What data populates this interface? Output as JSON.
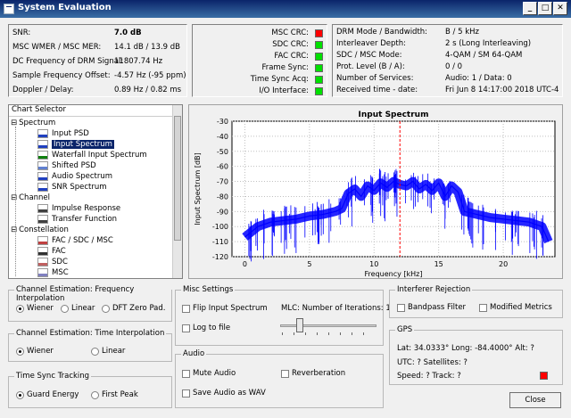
{
  "window": {
    "title": "System Evaluation",
    "buttons": [
      "_",
      "□",
      "✕"
    ]
  },
  "measurements": [
    {
      "label": "SNR:",
      "value": "7.0 dB"
    },
    {
      "label": "MSC WMER / MSC MER:",
      "value": "14.1 dB / 13.9 dB"
    },
    {
      "label": "DC Frequency of DRM Signal:",
      "value": "11807.74 Hz"
    },
    {
      "label": "Sample Frequency Offset:",
      "value": "-4.57 Hz (-95 ppm)"
    },
    {
      "label": "Doppler / Delay:",
      "value": "0.89 Hz / 0.82 ms"
    }
  ],
  "status_leds": [
    {
      "label": "MSC CRC:",
      "color": "#ff0000"
    },
    {
      "label": "SDC CRC:",
      "color": "#00e000"
    },
    {
      "label": "FAC CRC:",
      "color": "#00e000"
    },
    {
      "label": "Frame Sync:",
      "color": "#00e000"
    },
    {
      "label": "Time Sync Acq:",
      "color": "#00e000"
    },
    {
      "label": "I/O Interface:",
      "color": "#00e000"
    }
  ],
  "drm_info": [
    {
      "label": "DRM Mode / Bandwidth:",
      "value": "B / 5 kHz"
    },
    {
      "label": "Interleaver Depth:",
      "value": "2 s (Long Interleaving)"
    },
    {
      "label": "SDC / MSC Mode:",
      "value": "4-QAM / SM 64-QAM"
    },
    {
      "label": "Prot. Level (B / A):",
      "value": "0 / 0"
    },
    {
      "label": "Number of Services:",
      "value": "Audio: 1 / Data: 0"
    },
    {
      "label": "Received time - date:",
      "value": "Fri Jun 8 14:17:00 2018 UTC-4"
    }
  ],
  "chart_selector": {
    "header": "Chart Selector",
    "items": [
      {
        "label": "Spectrum",
        "level": 0,
        "icon": "tree-expand-icon"
      },
      {
        "label": "Input PSD",
        "level": 1,
        "icon": "psd-icon"
      },
      {
        "label": "Input Spectrum",
        "level": 1,
        "icon": "spectrum-icon",
        "selected": true
      },
      {
        "label": "Waterfall Input Spectrum",
        "level": 1,
        "icon": "waterfall-icon"
      },
      {
        "label": "Shifted PSD",
        "level": 1,
        "icon": "shifted-psd-icon"
      },
      {
        "label": "Audio Spectrum",
        "level": 1,
        "icon": "audio-spectrum-icon"
      },
      {
        "label": "SNR Spectrum",
        "level": 1,
        "icon": "snr-spectrum-icon"
      },
      {
        "label": "Channel",
        "level": 0,
        "icon": "tree-expand-icon"
      },
      {
        "label": "Impulse Response",
        "level": 1,
        "icon": "impulse-icon"
      },
      {
        "label": "Transfer Function",
        "level": 1,
        "icon": "transfer-icon"
      },
      {
        "label": "Constellation",
        "level": 0,
        "icon": "tree-expand-icon"
      },
      {
        "label": "FAC / SDC / MSC",
        "level": 1,
        "icon": "constellation-icon"
      },
      {
        "label": "FAC",
        "level": 1,
        "icon": "fac-icon"
      },
      {
        "label": "SDC",
        "level": 1,
        "icon": "sdc-icon"
      },
      {
        "label": "MSC",
        "level": 1,
        "icon": "msc-icon"
      }
    ]
  },
  "chart_data": {
    "type": "line",
    "title": "Input Spectrum",
    "xlabel": "Frequency [kHz]",
    "ylabel": "Input Spectrum [dB]",
    "xlim": [
      -1,
      24
    ],
    "ylim": [
      -120,
      -30
    ],
    "xticks": [
      0,
      5,
      10,
      15,
      20
    ],
    "yticks": [
      -30,
      -40,
      -50,
      -60,
      -70,
      -80,
      -90,
      -100,
      -110,
      -120
    ],
    "grid": true,
    "marker_x": 12,
    "series": [
      {
        "color": "#0000ff",
        "x": [
          0,
          1,
          2,
          3,
          4,
          5,
          6,
          7,
          7.5,
          8,
          8.5,
          9,
          9.5,
          10,
          10.5,
          11,
          11.5,
          12,
          12.5,
          13,
          13.5,
          14,
          14.5,
          15,
          15.5,
          16,
          16.5,
          17,
          18,
          19,
          20,
          21,
          22,
          23,
          23.5
        ],
        "values": [
          -107,
          -100,
          -97,
          -96,
          -95,
          -93,
          -92,
          -90,
          -88,
          -78,
          -75,
          -80,
          -73,
          -76,
          -71,
          -74,
          -70,
          -72,
          -73,
          -70,
          -75,
          -72,
          -76,
          -71,
          -80,
          -73,
          -77,
          -90,
          -92,
          -94,
          -95,
          -96,
          -97,
          -100,
          -110
        ]
      }
    ]
  },
  "freq_interp": {
    "title": "Channel Estimation: Frequency Interpolation",
    "options": [
      {
        "label": "Wiener",
        "checked": true
      },
      {
        "label": "Linear",
        "checked": false
      },
      {
        "label": "DFT Zero Pad.",
        "checked": false
      }
    ]
  },
  "time_interp": {
    "title": "Channel Estimation: Time Interpolation",
    "options": [
      {
        "label": "Wiener",
        "checked": true
      },
      {
        "label": "Linear",
        "checked": false
      }
    ]
  },
  "time_sync": {
    "title": "Time Sync Tracking",
    "options": [
      {
        "label": "Guard Energy",
        "checked": true
      },
      {
        "label": "First Peak",
        "checked": false
      }
    ]
  },
  "misc": {
    "title": "Misc Settings",
    "flip_label": "Flip Input Spectrum",
    "log_label": "Log to file",
    "mlc_label": "MLC: Number of Iterations: 1",
    "mlc_level": 0.2
  },
  "audio": {
    "title": "Audio",
    "mute_label": "Mute Audio",
    "reverb_label": "Reverberation",
    "save_label": "Save Audio as WAV"
  },
  "interferer": {
    "title": "Interferer Rejection",
    "bandpass_label": "Bandpass Filter",
    "metrics_label": "Modified Metrics"
  },
  "gps": {
    "title": "GPS",
    "line1": "Lat: 34.0333°  Long: -84.4000°  Alt: ?",
    "line2": "UTC: ?  Satellites: ?",
    "line3": "Speed: ?  Track: ?",
    "led_color": "#ff0000"
  },
  "close_label": "Close"
}
